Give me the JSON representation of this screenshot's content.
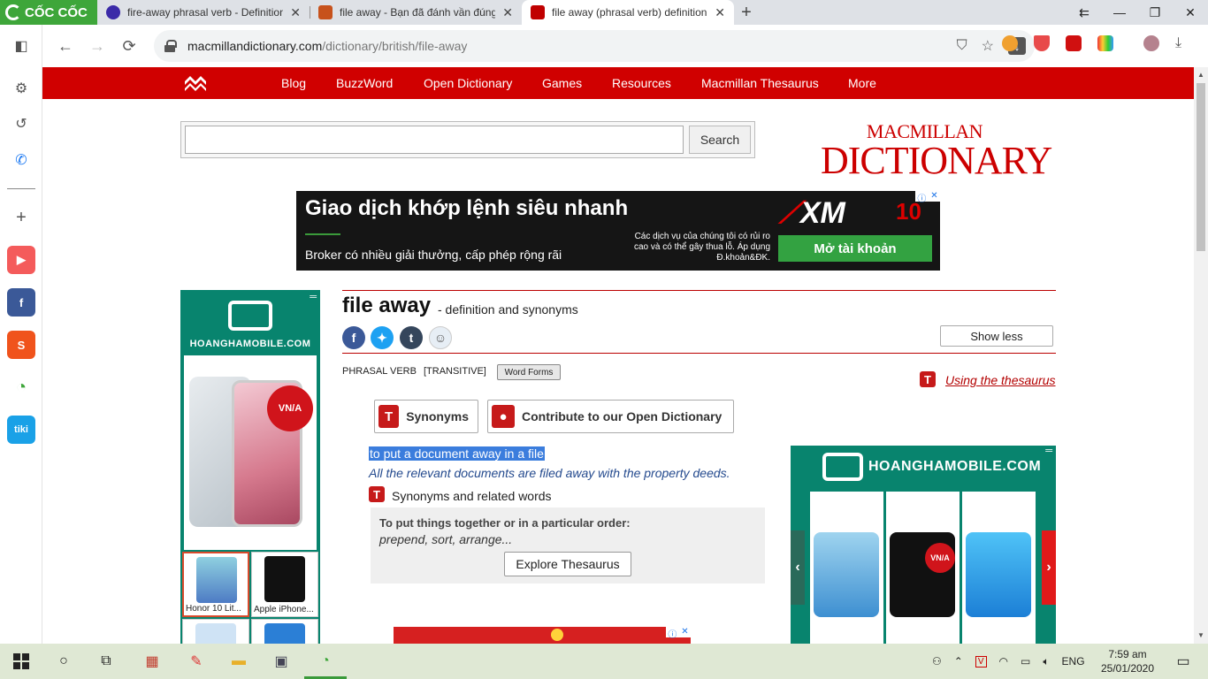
{
  "browser": {
    "brand": "CỐC CỐC",
    "tabs": [
      {
        "title": "fire-away phrasal verb - Definition",
        "favicon_color": "#3b2aa8"
      },
      {
        "title": "file away - Bạn đã đánh vần đúng",
        "favicon_color": "#c7521c"
      },
      {
        "title": "file away (phrasal verb) definition a",
        "favicon_color": "#c00000"
      }
    ],
    "url_host": "macmillandictionary.com",
    "url_path": "/dictionary/british/file-away"
  },
  "site": {
    "nav": [
      "Blog",
      "BuzzWord",
      "Open Dictionary",
      "Games",
      "Resources",
      "Macmillan Thesaurus",
      "More"
    ],
    "search_button": "Search",
    "search_placeholder": "",
    "brand_line1": "MACMILLAN",
    "brand_line2": "DICTIONARY"
  },
  "top_ad": {
    "headline": "Giao dịch khớp lệnh siêu nhanh",
    "sub": "Broker có nhiều giải thưởng, cấp phép rộng rãi",
    "risk": "Các dịch vụ của chúng tôi có rủi ro cao và có thể gây thua lỗ. Áp dụng Đ.khoản&ĐK.",
    "cta": "Mở tài khoản",
    "logo": "XM",
    "badge": "10"
  },
  "left_ad": {
    "logo": "HOANGHAMOBILE.COM",
    "menu": "═",
    "seal": "VN/A",
    "thumbs": [
      {
        "caption": "Honor 10 Lit...",
        "color": "#6ab0d8"
      },
      {
        "caption": "Apple iPhone...",
        "color": "#1a1a1a"
      }
    ]
  },
  "entry": {
    "headword": "file away",
    "sub": "- definition and synonyms",
    "show_less": "Show less",
    "pos": "PHRASAL VERB",
    "transitivity": "[TRANSITIVE]",
    "word_forms": "Word Forms",
    "using_thesaurus": "Using the thesaurus",
    "synonyms_btn": "Synonyms",
    "contribute_btn": "Contribute to our Open Dictionary",
    "definition": "to put a document away in a file",
    "example": "All the relevant documents are filed away with the property deeds.",
    "synonyms_heading": "Synonyms and related words",
    "syn_question": "To put things together or in a particular order:",
    "syn_words": "prepend, sort, arrange...",
    "explore": "Explore Thesaurus"
  },
  "social_icons": [
    "facebook-icon",
    "twitter-icon",
    "tumblr-icon",
    "reddit-icon"
  ],
  "right_ad": {
    "logo": "HOANGHAMOBILE.COM",
    "phones": [
      "#3d8fd1",
      "#111111",
      "#1c7fd6"
    ],
    "seal": "VN/A"
  },
  "taskbar": {
    "time": "7:59 am",
    "date": "25/01/2020",
    "lang": "ENG"
  }
}
